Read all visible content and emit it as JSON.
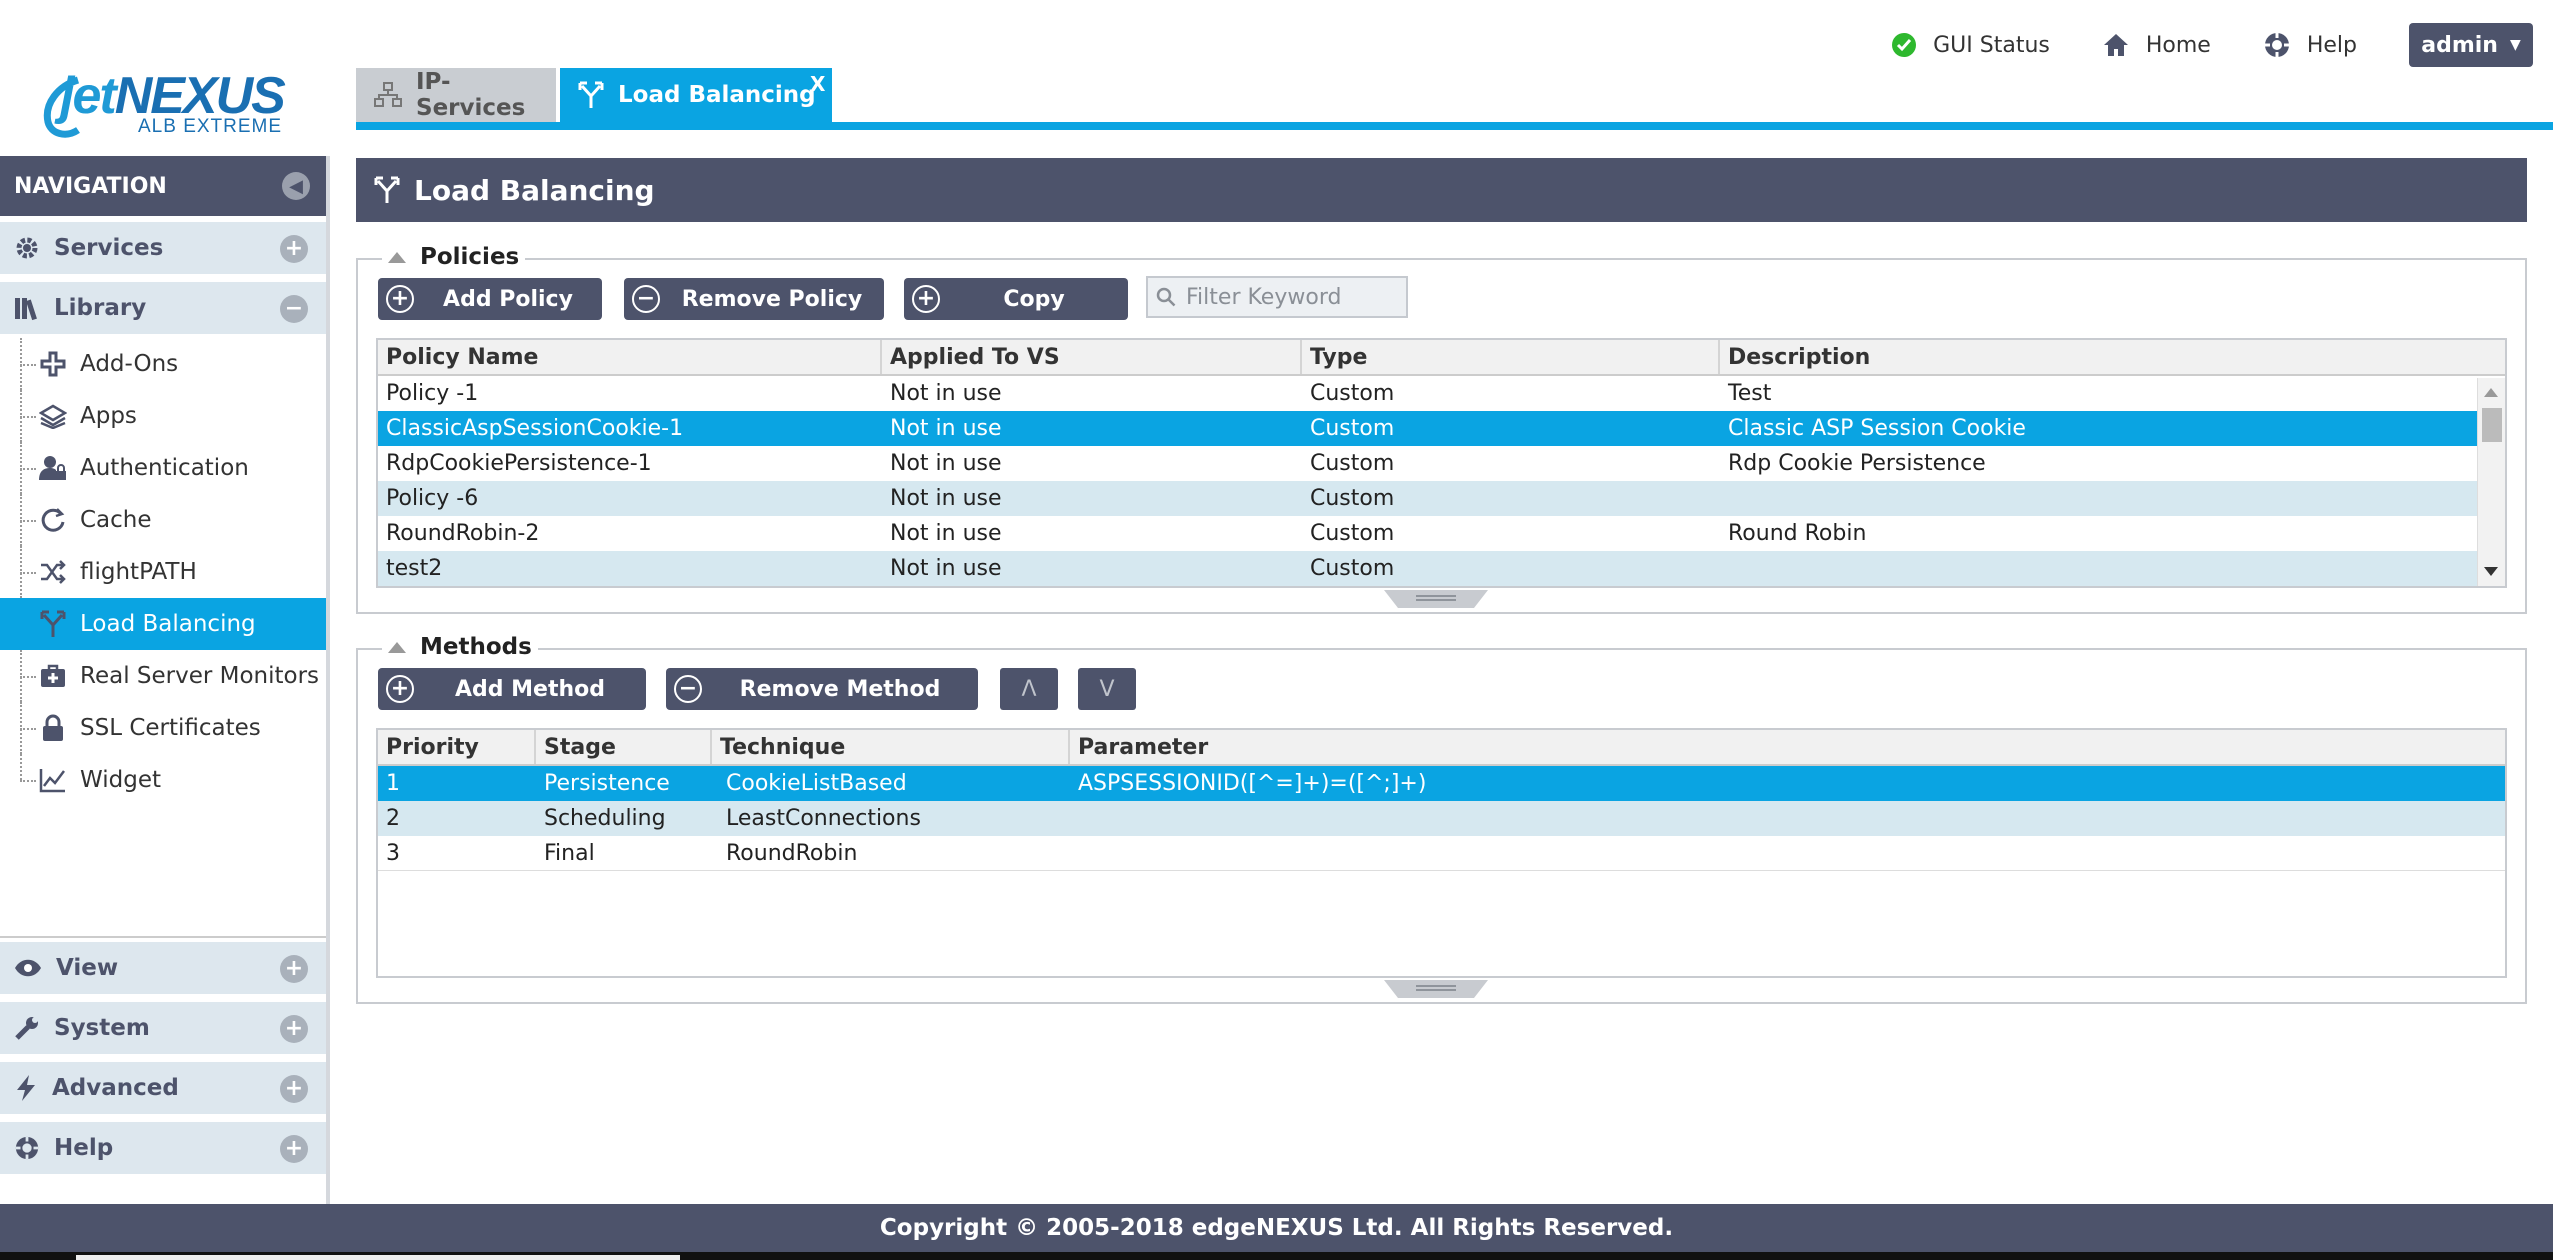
{
  "logo": {
    "word_a": "jet",
    "word_b": "NEXUS",
    "tagline": "ALB EXTREME"
  },
  "topnav": {
    "gui_status": "GUI Status",
    "home": "Home",
    "help": "Help",
    "user": "admin"
  },
  "tabs": {
    "ip_services": "IP-Services",
    "load_balancing": "Load Balancing",
    "close": "X"
  },
  "sidebar": {
    "title": "NAVIGATION",
    "sections_top": [
      {
        "label": "Services",
        "expanded": false
      },
      {
        "label": "Library",
        "expanded": true
      }
    ],
    "library_items": [
      {
        "label": "Add-Ons",
        "icon": "puzzle-icon"
      },
      {
        "label": "Apps",
        "icon": "apps-stack-icon"
      },
      {
        "label": "Authentication",
        "icon": "user-lock-icon"
      },
      {
        "label": "Cache",
        "icon": "cache-refresh-icon"
      },
      {
        "label": "flightPATH",
        "icon": "shuffle-icon"
      },
      {
        "label": "Load Balancing",
        "icon": "load-balancing-icon",
        "active": true
      },
      {
        "label": "Real Server Monitors",
        "icon": "monitor-plus-icon"
      },
      {
        "label": "SSL Certificates",
        "icon": "padlock-icon"
      },
      {
        "label": "Widget",
        "icon": "line-chart-icon"
      }
    ],
    "sections_bottom": [
      {
        "label": "View"
      },
      {
        "label": "System"
      },
      {
        "label": "Advanced"
      },
      {
        "label": "Help"
      }
    ]
  },
  "main": {
    "title": "Load Balancing",
    "policies": {
      "legend": "Policies",
      "buttons": {
        "add": "Add Policy",
        "remove": "Remove Policy",
        "copy": "Copy"
      },
      "filter_placeholder": "Filter Keyword",
      "columns": [
        "Policy Name",
        "Applied To VS",
        "Type",
        "Description"
      ],
      "rows": [
        {
          "name": "Policy -1",
          "applied": "Not in use",
          "type": "Custom",
          "description": "Test"
        },
        {
          "name": "ClassicAspSessionCookie-1",
          "applied": "Not in use",
          "type": "Custom",
          "description": "Classic ASP Session Cookie"
        },
        {
          "name": "RdpCookiePersistence-1",
          "applied": "Not in use",
          "type": "Custom",
          "description": "Rdp Cookie Persistence"
        },
        {
          "name": "Policy -6",
          "applied": "Not in use",
          "type": "Custom",
          "description": ""
        },
        {
          "name": "RoundRobin-2",
          "applied": "Not in use",
          "type": "Custom",
          "description": "Round Robin"
        },
        {
          "name": "test2",
          "applied": "Not in use",
          "type": "Custom",
          "description": ""
        }
      ],
      "selected_index": 1
    },
    "methods": {
      "legend": "Methods",
      "buttons": {
        "add": "Add Method",
        "remove": "Remove Method",
        "up": "Λ",
        "down": "V"
      },
      "columns": [
        "Priority",
        "Stage",
        "Technique",
        "Parameter"
      ],
      "rows": [
        {
          "priority": "1",
          "stage": "Persistence",
          "technique": "CookieListBased",
          "parameter": "ASPSESSIONID([^=]+)=([^;]+)"
        },
        {
          "priority": "2",
          "stage": "Scheduling",
          "technique": "LeastConnections",
          "parameter": ""
        },
        {
          "priority": "3",
          "stage": "Final",
          "technique": "RoundRobin",
          "parameter": ""
        }
      ],
      "selected_index": 0
    }
  },
  "footer": {
    "copyright": "Copyright © 2005-2018 edgeNEXUS Ltd. All Rights Reserved."
  },
  "colors": {
    "accent": "#0aa4e2",
    "header_dark": "#4d536b",
    "row_alt": "#d6e8f0",
    "status_ok": "#2eb82e"
  }
}
